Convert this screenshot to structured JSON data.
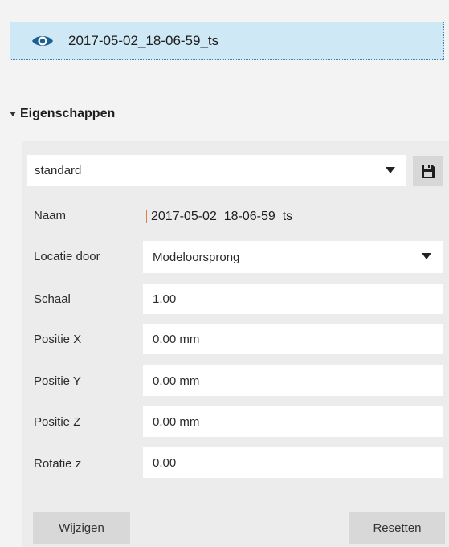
{
  "item": {
    "name": "2017-05-02_18-06-59_ts",
    "icon": "eye-icon",
    "accent": "#1c5f94"
  },
  "section": {
    "title": "Eigenschappen"
  },
  "preset": {
    "selected": "standard",
    "save_icon": "floppy-disk-icon"
  },
  "properties": {
    "name_label": "Naam",
    "name_value": "2017-05-02_18-06-59_ts",
    "location_label": "Locatie door",
    "location_value": "Modeloorsprong",
    "scale_label": "Schaal",
    "scale_value": "1.00",
    "pos_x_label": "Positie X",
    "pos_x_value": "0.00 mm",
    "pos_y_label": "Positie Y",
    "pos_y_value": "0.00 mm",
    "pos_z_label": "Positie Z",
    "pos_z_value": "0.00 mm",
    "rot_z_label": "Rotatie z",
    "rot_z_value": "0.00"
  },
  "buttons": {
    "change": "Wijzigen",
    "reset": "Resetten"
  }
}
